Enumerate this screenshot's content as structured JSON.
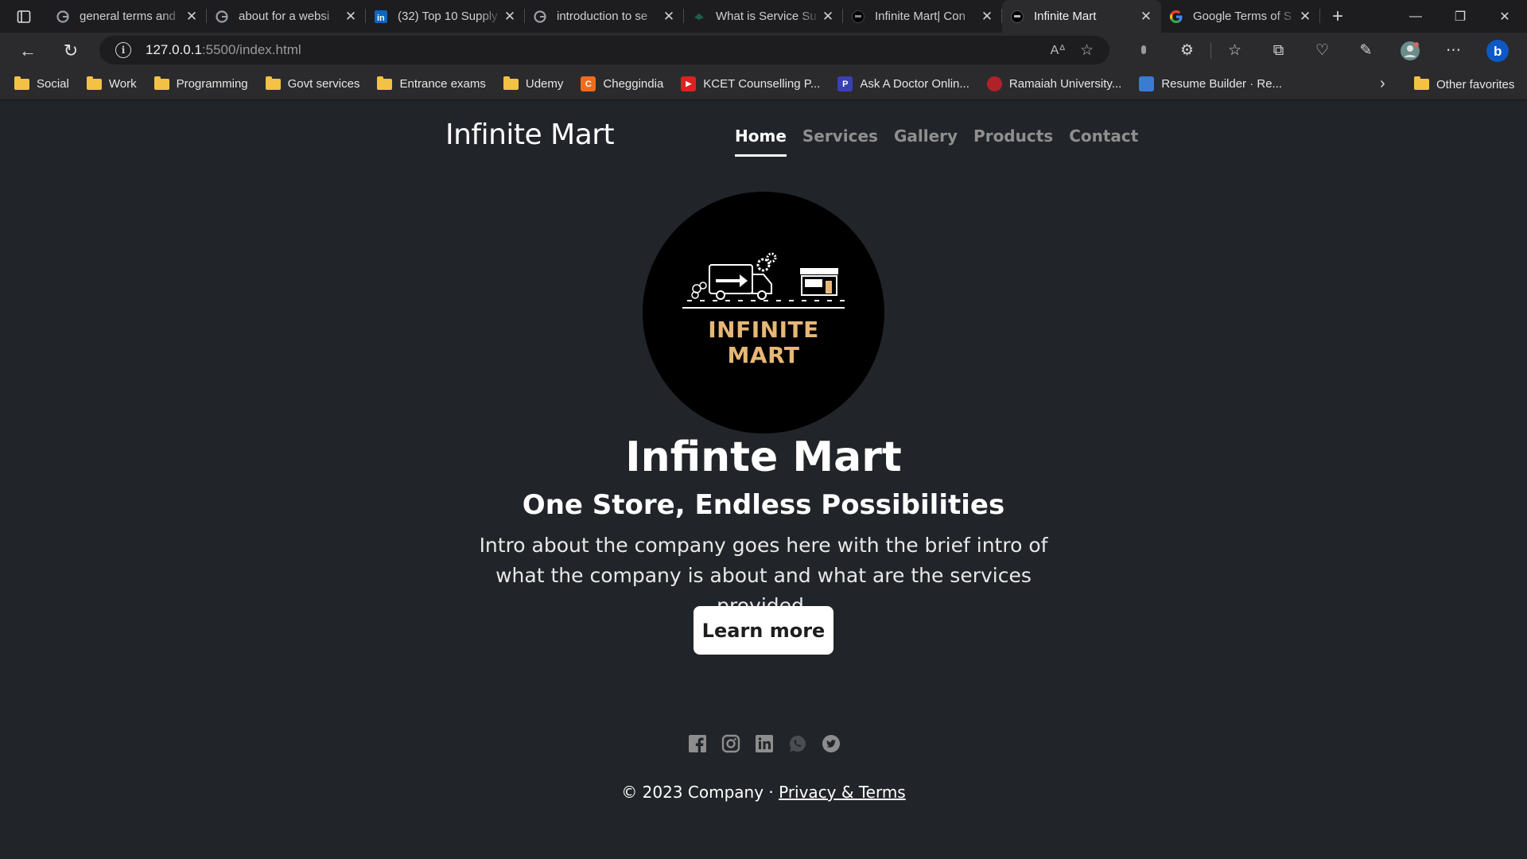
{
  "browser": {
    "tabs": [
      {
        "title": "general terms and",
        "icon": "google-icon"
      },
      {
        "title": "about for a websi",
        "icon": "google-icon"
      },
      {
        "title": "(32) Top 10 Supply",
        "icon": "linkedin-icon"
      },
      {
        "title": "introduction to se",
        "icon": "google-icon"
      },
      {
        "title": "What is Service Su",
        "icon": "site-icon"
      },
      {
        "title": "Infinite Mart| Con",
        "icon": "site-icon"
      },
      {
        "title": "Infinite Mart",
        "icon": "site-icon",
        "active": true
      },
      {
        "title": "Google Terms of S",
        "icon": "google-icon"
      }
    ],
    "url_host": "127.0.0.1",
    "url_rest": ":5500/index.html",
    "favorites": [
      {
        "label": "Social",
        "type": "folder"
      },
      {
        "label": "Work",
        "type": "folder"
      },
      {
        "label": "Programming",
        "type": "folder"
      },
      {
        "label": "Govt services",
        "type": "folder"
      },
      {
        "label": "Entrance exams",
        "type": "folder"
      },
      {
        "label": "Udemy",
        "type": "folder"
      },
      {
        "label": "Cheggindia",
        "type": "site",
        "badge": "C",
        "color": "#f26b1d"
      },
      {
        "label": "KCET Counselling P...",
        "type": "site",
        "badge": "▶",
        "color": "#e02020"
      },
      {
        "label": "Ask A Doctor Onlin...",
        "type": "site",
        "badge": "P",
        "color": "#3b3fb6"
      },
      {
        "label": "Ramaiah University...",
        "type": "site",
        "badge": "",
        "color": "#b0222a"
      },
      {
        "label": "Resume Builder · Re...",
        "type": "site",
        "badge": "",
        "color": "#3a7bd5"
      }
    ],
    "other_favorites": "Other favorites"
  },
  "site": {
    "brand": "Infinite Mart",
    "nav": [
      "Home",
      "Services",
      "Gallery",
      "Products",
      "Contact"
    ],
    "logo_line1": "INFINITE",
    "logo_line2": "MART",
    "hero_title": "Infinte Mart",
    "hero_subtitle": "One Store, Endless Possibilities",
    "hero_intro": "Intro about the company goes here with the brief intro of what the company is about and what are the services provided.",
    "cta": "Learn more",
    "socials": [
      "facebook-icon",
      "instagram-icon",
      "linkedin-icon",
      "whatsapp-icon",
      "twitter-icon"
    ],
    "copyright": "© 2023 Company ·",
    "privacy_link": "Privacy & Terms"
  },
  "colors": {
    "page_bg": "#212529",
    "logo_text": "#e7b776",
    "folder": "#f3c244"
  }
}
